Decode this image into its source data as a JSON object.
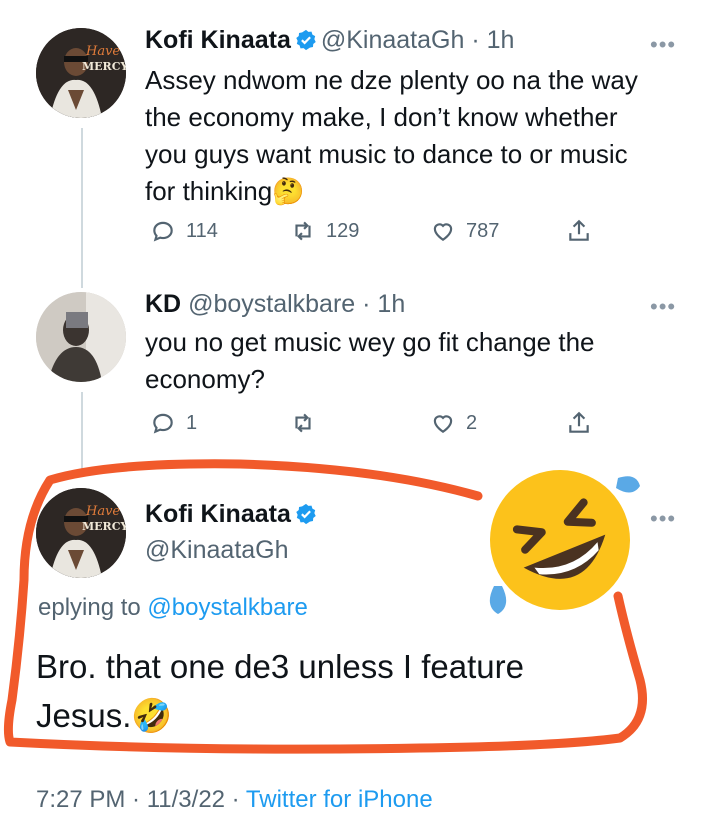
{
  "tweet1": {
    "display_name": "Kofi Kinaata",
    "handle": "@KinaataGh",
    "time": "· 1h",
    "text_lines": [
      "Assey ndwom ne dze plenty oo na the way",
      "the economy make, I don’t know whether",
      "you guys want music to dance to or music",
      "for thinking"
    ],
    "emoji": "🤔",
    "replies": "114",
    "retweets": "129",
    "likes": "787",
    "avatar_text_top": "Have",
    "avatar_text_bottom": "MERCY"
  },
  "tweet2": {
    "display_name": "KD",
    "handle": "@boystalkbare",
    "time": "· 1h",
    "text_lines": [
      "you no get music wey go fit change the",
      "economy?"
    ],
    "replies": "1",
    "retweets": "",
    "likes": "2"
  },
  "tweet3": {
    "display_name": "Kofi Kinaata",
    "handle": "@KinaataGh",
    "replying_prefix": "eplying to ",
    "replying_to": "@boystalkbare",
    "text_line1": "Bro. that one de3 unless I feature",
    "text_line2": "Jesus.",
    "emoji": "🤣",
    "avatar_text_top": "Have",
    "avatar_text_bottom": "MERCY"
  },
  "footer": {
    "time": "7:27 PM",
    "separator1": " · ",
    "date": "11/3/22",
    "separator2": " · ",
    "source": "Twitter for iPhone"
  },
  "more_glyph": "•••",
  "annotation_emoji": "🤣",
  "colors": {
    "accent": "#1d9bf0",
    "annotation": "#f15a2b",
    "muted": "#536471"
  }
}
